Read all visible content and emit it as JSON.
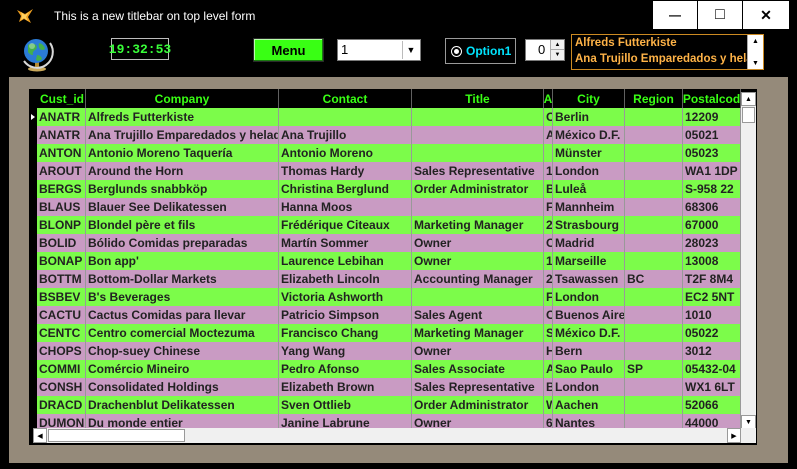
{
  "window": {
    "title": "This is a new titlebar on top level form",
    "minimize_glyph": "—",
    "maximize_glyph": "□",
    "close_glyph": "✕"
  },
  "toolbar": {
    "clock": "19:32:53",
    "menu_label": "Menu",
    "combo_value": "1",
    "option_label": "Option1",
    "spinner_value": "0",
    "listbox_items": [
      "Alfreds Futterkiste",
      "Ana Trujillo Emparedados y helados"
    ]
  },
  "grid": {
    "columns": [
      {
        "key": "cust_id",
        "label": "Cust_id"
      },
      {
        "key": "company",
        "label": "Company"
      },
      {
        "key": "contact",
        "label": "Contact"
      },
      {
        "key": "title",
        "label": "Title"
      },
      {
        "key": "address",
        "label": "A"
      },
      {
        "key": "city",
        "label": "City"
      },
      {
        "key": "region",
        "label": "Region"
      },
      {
        "key": "postalcode",
        "label": "Postalcod"
      }
    ],
    "rows": [
      {
        "cust_id": "ANATR",
        "company": "Alfreds Futterkiste",
        "contact": "",
        "title": "",
        "address": "O",
        "city": "Berlin",
        "region": "",
        "postalcode": "12209"
      },
      {
        "cust_id": "ANATR",
        "company": "Ana Trujillo Emparedados y helad",
        "contact": "Ana Trujillo",
        "title": "",
        "address": "A",
        "city": "México D.F.",
        "region": "",
        "postalcode": "05021"
      },
      {
        "cust_id": "ANTON",
        "company": "Antonio Moreno Taquería",
        "contact": "Antonio Moreno",
        "title": "",
        "address": "",
        "city": "Münster",
        "region": "",
        "postalcode": "05023"
      },
      {
        "cust_id": "AROUT",
        "company": "Around the Horn",
        "contact": "Thomas Hardy",
        "title": "Sales Representative",
        "address": "1",
        "city": "London",
        "region": "",
        "postalcode": "WA1 1DP"
      },
      {
        "cust_id": "BERGS",
        "company": "Berglunds snabbköp",
        "contact": "Christina Berglund",
        "title": "Order Administrator",
        "address": "B",
        "city": "Luleå",
        "region": "",
        "postalcode": "S-958 22"
      },
      {
        "cust_id": "BLAUS",
        "company": "Blauer See Delikatessen",
        "contact": "Hanna Moos",
        "title": "",
        "address": "F",
        "city": "Mannheim",
        "region": "",
        "postalcode": "68306"
      },
      {
        "cust_id": "BLONP",
        "company": "Blondel père et fils",
        "contact": "Frédérique Citeaux",
        "title": "Marketing Manager",
        "address": "2",
        "city": "Strasbourg",
        "region": "",
        "postalcode": "67000"
      },
      {
        "cust_id": "BOLID",
        "company": "Bólido Comidas preparadas",
        "contact": "Martín Sommer",
        "title": "Owner",
        "address": "C",
        "city": "Madrid",
        "region": "",
        "postalcode": "28023"
      },
      {
        "cust_id": "BONAP",
        "company": "Bon app'",
        "contact": "Laurence Lebihan",
        "title": "Owner",
        "address": "1",
        "city": "Marseille",
        "region": "",
        "postalcode": "13008"
      },
      {
        "cust_id": "BOTTM",
        "company": "Bottom-Dollar Markets",
        "contact": "Elizabeth Lincoln",
        "title": "Accounting Manager",
        "address": "2",
        "city": "Tsawassen",
        "region": "BC",
        "postalcode": "T2F 8M4"
      },
      {
        "cust_id": "BSBEV",
        "company": "B's Beverages",
        "contact": "Victoria Ashworth",
        "title": "",
        "address": "F",
        "city": "London",
        "region": "",
        "postalcode": "EC2 5NT"
      },
      {
        "cust_id": "CACTU",
        "company": "Cactus Comidas para llevar",
        "contact": "Patricio Simpson",
        "title": "Sales Agent",
        "address": "C",
        "city": "Buenos Aire",
        "region": "",
        "postalcode": "1010"
      },
      {
        "cust_id": "CENTC",
        "company": "Centro comercial Moctezuma",
        "contact": "Francisco Chang",
        "title": "Marketing Manager",
        "address": "S",
        "city": "México D.F.",
        "region": "",
        "postalcode": "05022"
      },
      {
        "cust_id": "CHOPS",
        "company": "Chop-suey Chinese",
        "contact": "Yang Wang",
        "title": "Owner",
        "address": "H",
        "city": "Bern",
        "region": "",
        "postalcode": "3012"
      },
      {
        "cust_id": "COMMI",
        "company": "Comércio Mineiro",
        "contact": "Pedro Afonso",
        "title": "Sales Associate",
        "address": "A",
        "city": "Sao Paulo",
        "region": "SP",
        "postalcode": "05432-04"
      },
      {
        "cust_id": "CONSH",
        "company": "Consolidated Holdings",
        "contact": "Elizabeth Brown",
        "title": "Sales Representative",
        "address": "B",
        "city": "London",
        "region": "",
        "postalcode": "WX1 6LT"
      },
      {
        "cust_id": "DRACD",
        "company": "Drachenblut Delikatessen",
        "contact": "Sven Ottlieb",
        "title": "Order Administrator",
        "address": "W",
        "city": "Aachen",
        "region": "",
        "postalcode": "52066"
      },
      {
        "cust_id": "DUMON",
        "company": "Du monde entier",
        "contact": "Janine Labrune",
        "title": "Owner",
        "address": "6",
        "city": "Nantes",
        "region": "",
        "postalcode": "44000"
      }
    ]
  },
  "colors": {
    "row_green": "#7cfc4a",
    "row_purple": "#c99bc3",
    "panel": "#958a7a",
    "header_text": "#39ff14"
  }
}
